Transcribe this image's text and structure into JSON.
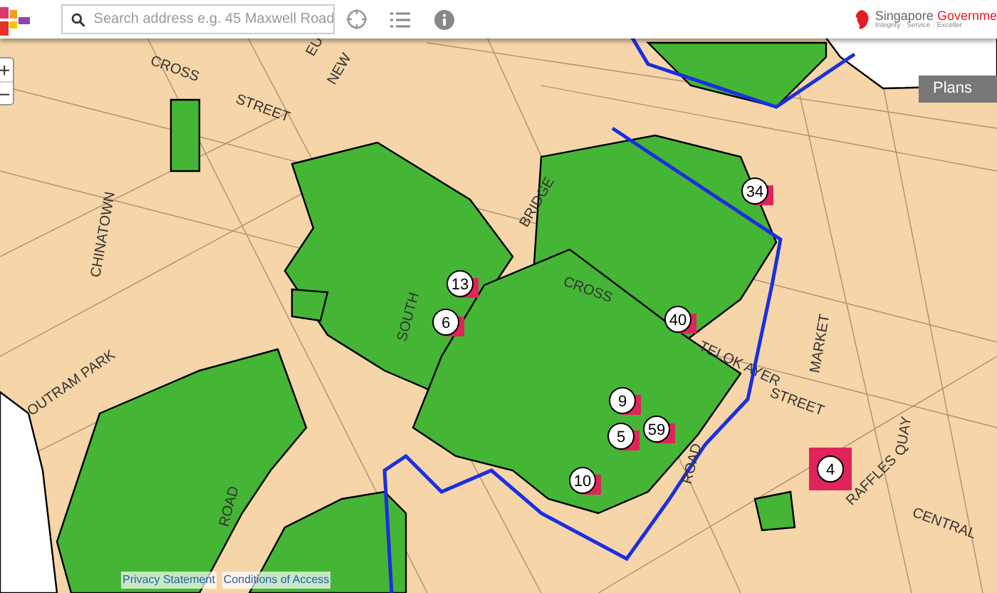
{
  "header": {
    "search": {
      "placeholder": "Search address e.g. 45 Maxwell Road"
    },
    "gov_logo": {
      "name_part1": "Singapore",
      "name_part2": "Governme",
      "tagline": "Integrity · Service · Exceller"
    }
  },
  "map_controls": {
    "zoom_in": "+",
    "zoom_out": "−",
    "plans_button": "Plans"
  },
  "map": {
    "street_labels": [
      "CROSS",
      "STREET",
      "CHINATOWN",
      "BRIDGE",
      "SOUTH",
      "CROSS",
      "TELOK AYER",
      "STREET",
      "MARKET",
      "RAFFLES",
      "CENTRAL",
      "QUAY",
      "ROAD",
      "OUTRAM PARK",
      "ROAD",
      "EU",
      "NEW"
    ],
    "markers": [
      {
        "label": "34"
      },
      {
        "label": "13"
      },
      {
        "label": "6"
      },
      {
        "label": "40"
      },
      {
        "label": "9"
      },
      {
        "label": "5"
      },
      {
        "label": "59"
      },
      {
        "label": "10"
      },
      {
        "label": "4"
      }
    ]
  },
  "footer": {
    "links": [
      "Privacy Statement",
      "Conditions of Access"
    ]
  }
}
